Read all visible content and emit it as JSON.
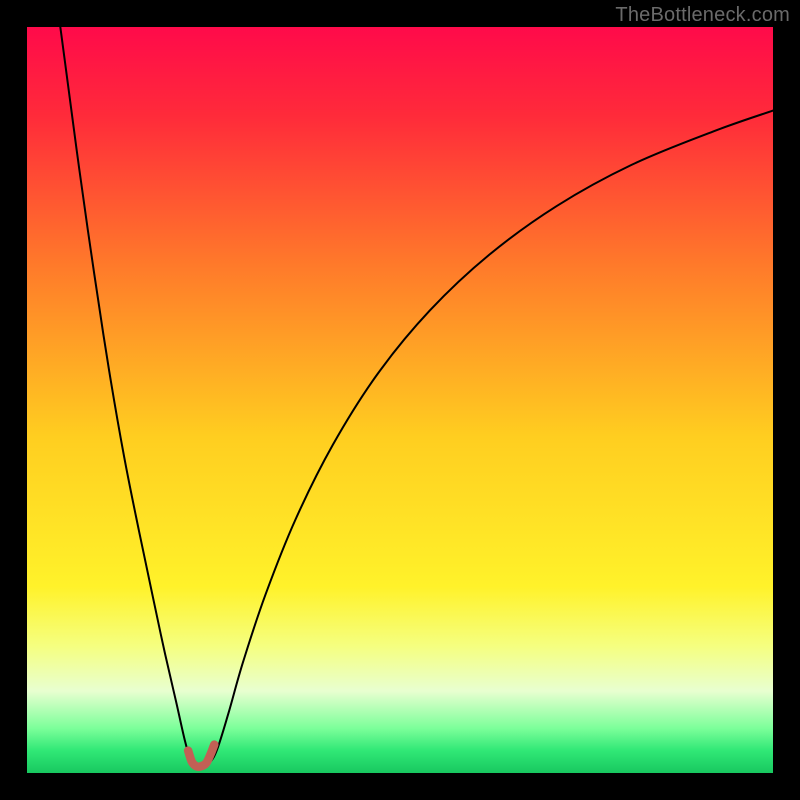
{
  "watermark": "TheBottleneck.com",
  "chart_data": {
    "type": "line",
    "title": "",
    "xlabel": "",
    "ylabel": "",
    "xlim": [
      0,
      100
    ],
    "ylim": [
      0,
      100
    ],
    "background_gradient": {
      "stops": [
        {
          "offset": 0.0,
          "color": "#ff0a4a"
        },
        {
          "offset": 0.12,
          "color": "#ff2b3a"
        },
        {
          "offset": 0.32,
          "color": "#ff7a2a"
        },
        {
          "offset": 0.55,
          "color": "#ffce20"
        },
        {
          "offset": 0.75,
          "color": "#fff22a"
        },
        {
          "offset": 0.83,
          "color": "#f5ff80"
        },
        {
          "offset": 0.89,
          "color": "#e8ffd0"
        },
        {
          "offset": 0.94,
          "color": "#7cff9a"
        },
        {
          "offset": 0.97,
          "color": "#30e876"
        },
        {
          "offset": 1.0,
          "color": "#18c860"
        }
      ]
    },
    "series": [
      {
        "name": "bottleneck-curve",
        "color": "#000000",
        "width": 2.0,
        "points": [
          [
            3.8,
            105.0
          ],
          [
            5.0,
            96.0
          ],
          [
            7.0,
            81.0
          ],
          [
            9.0,
            67.0
          ],
          [
            11.0,
            54.0
          ],
          [
            13.0,
            42.5
          ],
          [
            15.0,
            32.5
          ],
          [
            17.0,
            23.0
          ],
          [
            18.5,
            16.0
          ],
          [
            20.0,
            9.5
          ],
          [
            21.2,
            4.2
          ],
          [
            22.0,
            1.6
          ],
          [
            22.8,
            0.7
          ],
          [
            23.5,
            0.7
          ],
          [
            24.5,
            1.4
          ],
          [
            25.5,
            3.2
          ],
          [
            27.0,
            8.0
          ],
          [
            29.0,
            15.0
          ],
          [
            32.0,
            24.0
          ],
          [
            36.0,
            34.0
          ],
          [
            41.0,
            44.0
          ],
          [
            47.0,
            53.5
          ],
          [
            54.0,
            62.0
          ],
          [
            62.0,
            69.5
          ],
          [
            71.0,
            76.0
          ],
          [
            81.0,
            81.5
          ],
          [
            92.0,
            86.0
          ],
          [
            100.0,
            88.8
          ]
        ]
      },
      {
        "name": "bottleneck-highlight",
        "color": "#c26055",
        "width": 8.5,
        "points": [
          [
            21.6,
            3.0
          ],
          [
            22.1,
            1.5
          ],
          [
            22.7,
            0.9
          ],
          [
            23.3,
            0.9
          ],
          [
            24.0,
            1.3
          ],
          [
            24.6,
            2.5
          ],
          [
            25.1,
            3.8
          ]
        ]
      }
    ]
  }
}
